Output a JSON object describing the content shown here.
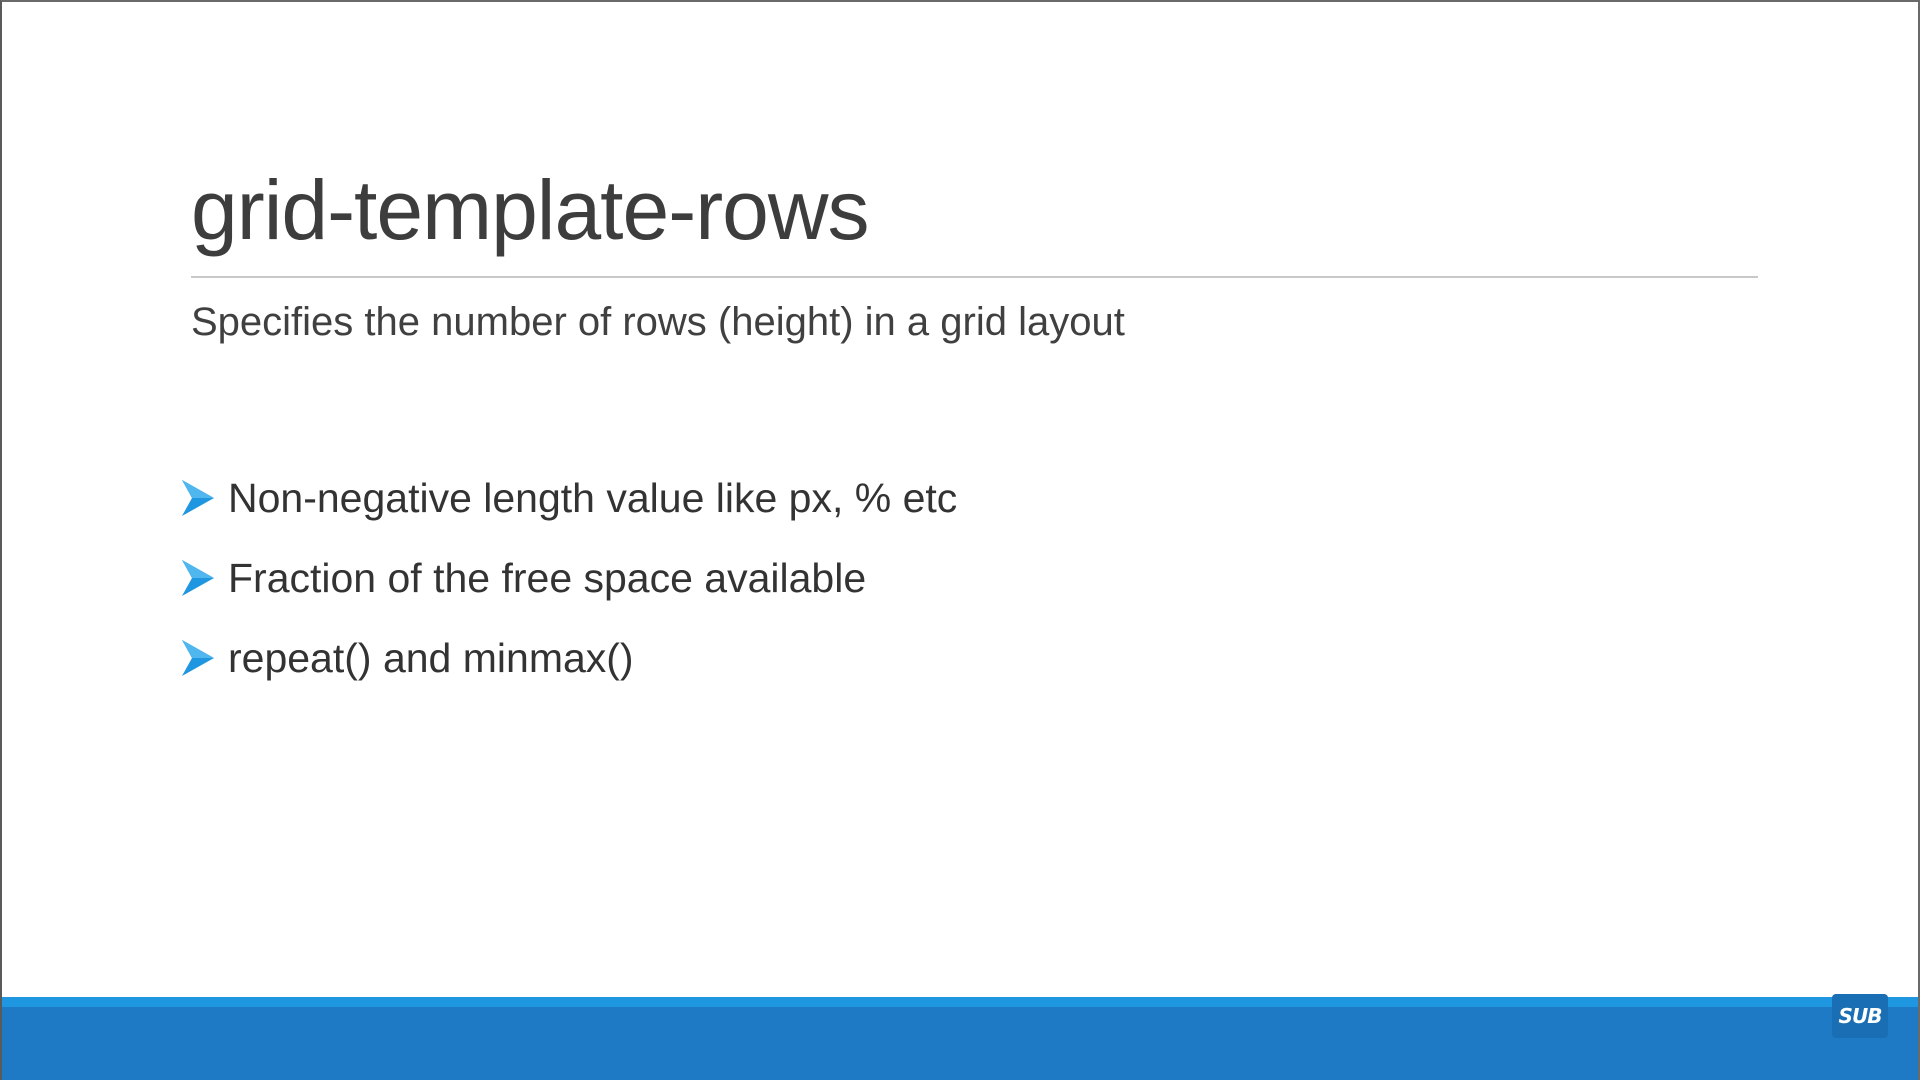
{
  "slide": {
    "title": "grid-template-rows",
    "subtitle": "Specifies the number of rows (height) in a grid layout",
    "bullets": [
      {
        "icon": "arrow-bullet-icon",
        "text": "Non-negative length value like px, % etc"
      },
      {
        "icon": "arrow-bullet-icon",
        "text": "Fraction of the free space available"
      },
      {
        "icon": "arrow-bullet-icon",
        "text": "repeat() and minmax()"
      }
    ]
  },
  "footer": {
    "badge": "SUB"
  },
  "colors": {
    "accent": "#1e96e0",
    "footer": "#1f7ac6",
    "title": "#3d3d3d"
  }
}
